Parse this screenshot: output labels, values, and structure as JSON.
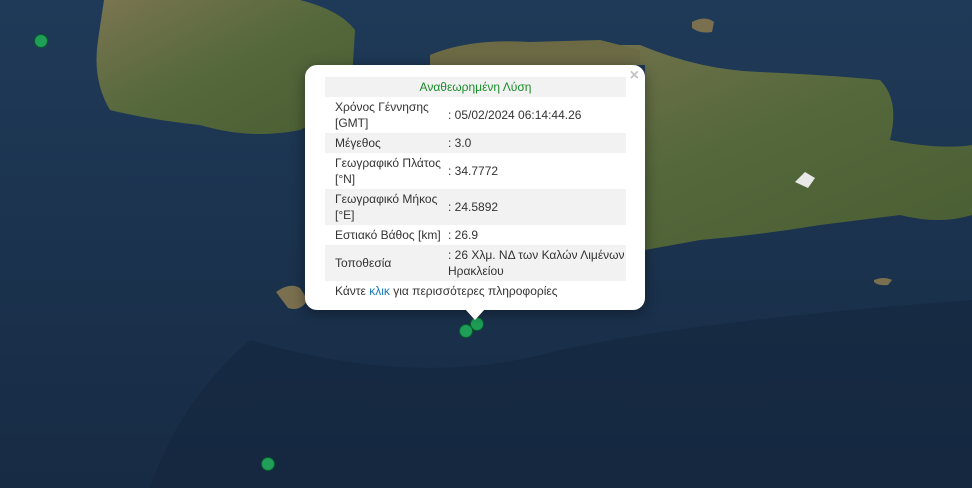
{
  "map": {
    "background": "satellite",
    "sea_color": "#1c3550",
    "land_color": "#5a6b3e",
    "marker_color": "#1e9e57"
  },
  "popup": {
    "title": "Αναθεωρημένη Λύση",
    "close": "×",
    "rows": [
      {
        "label": "Χρόνος Γέννησης [GMT]",
        "value": ": 05/02/2024 06:14:44.26"
      },
      {
        "label": "Μέγεθος",
        "value": ": 3.0"
      },
      {
        "label": "Γεωγραφικό Πλάτος [°N]",
        "value": ": 34.7772"
      },
      {
        "label": "Γεωγραφικό Μήκος [°E]",
        "value": ": 24.5892"
      },
      {
        "label": "Εστιακό Βάθος [km]",
        "value": ": 26.9"
      },
      {
        "label": "Τοποθεσία",
        "value": ": 26 Χλμ. ΝΔ των Καλών Λιμένων Ηρακλείου"
      }
    ],
    "more_prefix": "Κάντε ",
    "more_link": "κλικ",
    "more_suffix": " για περισσότερες πληροφορίες"
  }
}
